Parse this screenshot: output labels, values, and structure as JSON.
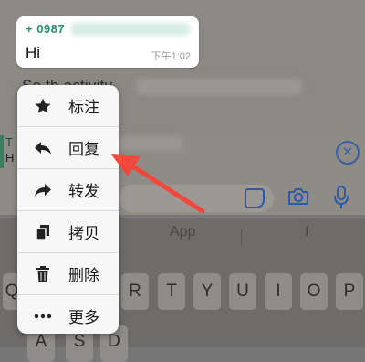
{
  "chat": {
    "bubble": {
      "sender_visible": "+ 0987",
      "text": "Hi",
      "time": "下午1:02"
    },
    "background_partial_text": "So th    activity"
  },
  "reply_bar": {
    "letter_1": "T",
    "letter_2": "H"
  },
  "keyboard": {
    "suggestions": [
      "App",
      "I"
    ],
    "row_keys": [
      "Q",
      "R",
      "T",
      "Y",
      "U",
      "I",
      "O",
      "P"
    ],
    "row2_keys": [
      "A",
      "S",
      "D"
    ]
  },
  "context_menu": {
    "items": [
      {
        "label": "标注",
        "icon": "star-icon"
      },
      {
        "label": "回复",
        "icon": "reply-icon"
      },
      {
        "label": "转发",
        "icon": "forward-icon"
      },
      {
        "label": "拷贝",
        "icon": "copy-icon"
      },
      {
        "label": "删除",
        "icon": "trash-icon"
      },
      {
        "label": "更多",
        "icon": "more-icon"
      }
    ]
  },
  "colors": {
    "accent_green": "#2a8c6e",
    "icon_blue": "#2c5aa8",
    "annotation_red": "#f2473d"
  }
}
